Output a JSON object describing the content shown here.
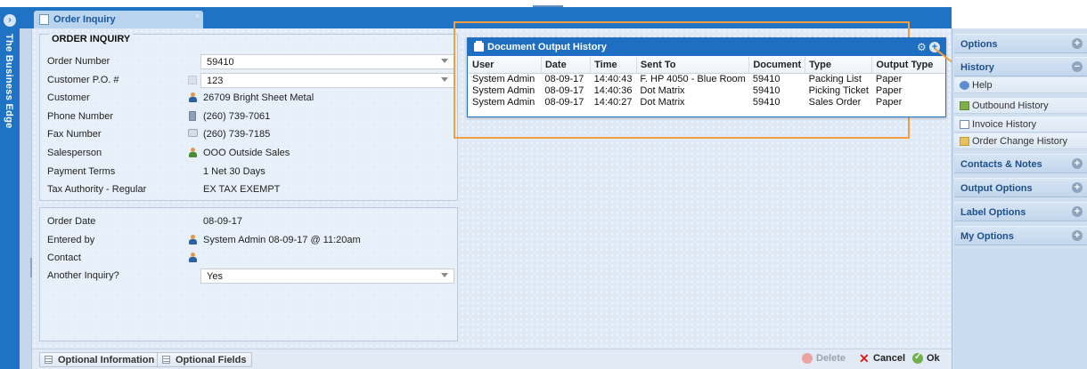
{
  "app": {
    "vertical_title": "The Business Edge"
  },
  "tab": {
    "label": "Order Inquiry",
    "close": "×"
  },
  "inquiry": {
    "legend": "ORDER INQUIRY",
    "fields": [
      {
        "label": "Order Number",
        "value": "59410"
      },
      {
        "label": "Customer P.O. #",
        "value": "123"
      },
      {
        "label": "Customer",
        "value": "26709 Bright Sheet Metal"
      },
      {
        "label": "Phone Number",
        "value": "(260) 739-7061"
      },
      {
        "label": "Fax Number",
        "value": "(260) 739-7185"
      },
      {
        "label": "Salesperson",
        "value": "OOO Outside Sales"
      },
      {
        "label": "Payment Terms",
        "value": "1 Net 30 Days"
      },
      {
        "label": "Tax Authority - Regular",
        "value": "EX TAX EXEMPT"
      }
    ]
  },
  "order_info": {
    "fields": [
      {
        "label": "Order Date",
        "value": "08-09-17"
      },
      {
        "label": "Entered by",
        "value": "System Admin 08-09-17 @ 11:20am"
      },
      {
        "label": "Contact",
        "value": ""
      },
      {
        "label": "Another Inquiry?",
        "value": "Yes"
      }
    ]
  },
  "doc_history": {
    "title": "Document Output History",
    "columns": [
      "User",
      "Date",
      "Time",
      "Sent To",
      "Document",
      "Type",
      "Output Type"
    ],
    "rows": [
      [
        "System Admin",
        "08-09-17",
        "14:40:43",
        "F. HP 4050 - Blue Room",
        "59410",
        "Packing List",
        "Paper"
      ],
      [
        "System Admin",
        "08-09-17",
        "14:40:36",
        "Dot Matrix",
        "59410",
        "Picking Ticket",
        "Paper"
      ],
      [
        "System Admin",
        "08-09-17",
        "14:40:27",
        "Dot Matrix",
        "59410",
        "Sales Order",
        "Paper"
      ]
    ]
  },
  "bottom": {
    "optional_information": "Optional Information",
    "optional_fields": "Optional Fields",
    "delete": "Delete",
    "cancel": "Cancel",
    "ok": "Ok"
  },
  "sidebar": {
    "options": "Options",
    "history": "History",
    "history_items": [
      "Help",
      "Outbound History",
      "Invoice History",
      "Order Change History"
    ],
    "contacts_notes": "Contacts & Notes",
    "output_options": "Output Options",
    "label_options": "Label Options",
    "my_options": "My Options"
  },
  "colors": {
    "accent": "#1f72c4",
    "highlight": "#f0a040"
  }
}
